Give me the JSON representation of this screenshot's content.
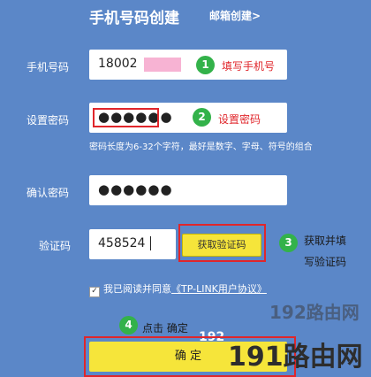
{
  "header": {
    "title": "手机号码创建",
    "email_link": "邮箱创建>"
  },
  "phone": {
    "label": "手机号码",
    "value": "18002",
    "annotation": "填写手机号"
  },
  "password": {
    "label": "设置密码",
    "value": "●●●●●●",
    "annotation": "设置密码",
    "hint": "密码长度为6-32个字符，最好是数字、字母、符号的组合"
  },
  "confirm_password": {
    "label": "确认密码",
    "value": "●●●●●●"
  },
  "captcha": {
    "label": "验证码",
    "value": "458524",
    "button_label": "获取验证码",
    "annotation_line1": "获取并填",
    "annotation_line2": "写验证码"
  },
  "agreement": {
    "checkbox_mark": "✓",
    "text": "我已阅读并同意",
    "link": "《TP-LINK用户协议》"
  },
  "submit": {
    "annotation": "点击 确定",
    "button_label": "确 定"
  },
  "steps": [
    "1",
    "2",
    "3",
    "4"
  ],
  "watermark": {
    "small_number": "192",
    "small_text": "路由网",
    "big_number": "191",
    "big_text": "路由网"
  },
  "colors": {
    "background": "#5b87c8",
    "button": "#f6e53a",
    "highlight_red": "#e0262b",
    "step_green": "#33b24a"
  }
}
